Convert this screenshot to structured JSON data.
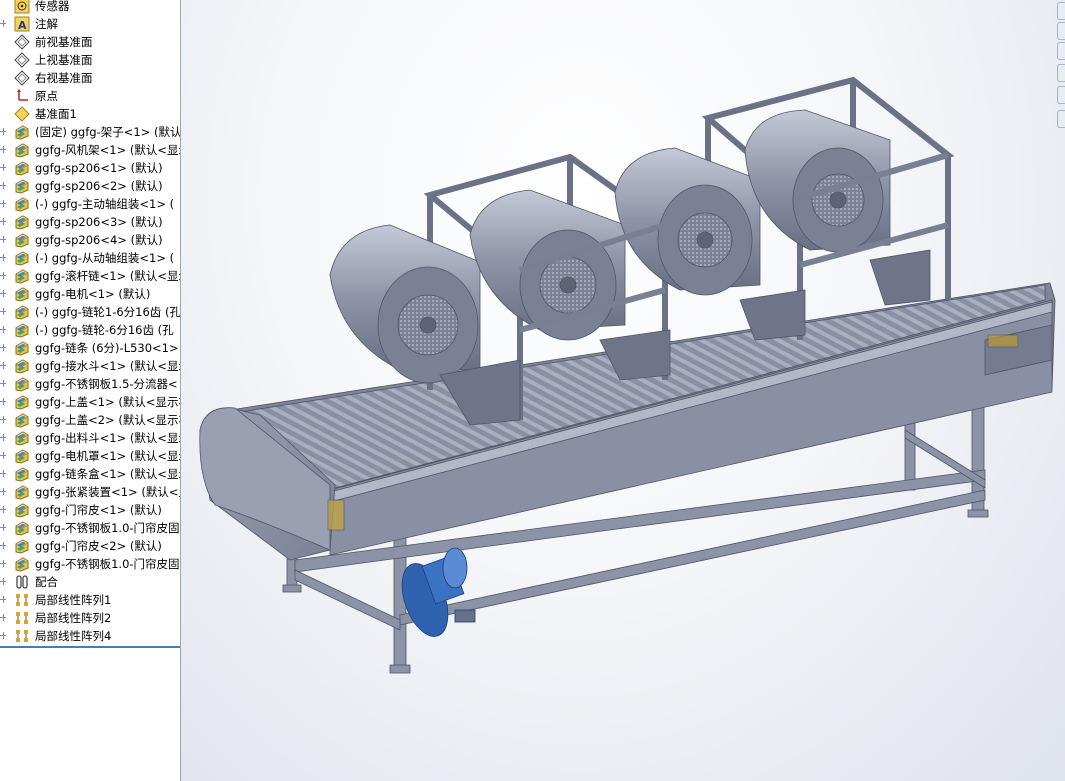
{
  "tree": {
    "items": [
      {
        "label": "传感器",
        "icon": "sensor-icon",
        "expander": false
      },
      {
        "label": "注解",
        "icon": "annotation-icon",
        "expander": true
      },
      {
        "label": "前视基准面",
        "icon": "plane-icon",
        "expander": false
      },
      {
        "label": "上视基准面",
        "icon": "plane-icon",
        "expander": false
      },
      {
        "label": "右视基准面",
        "icon": "plane-icon",
        "expander": false
      },
      {
        "label": "原点",
        "icon": "origin-icon",
        "expander": false
      },
      {
        "label": "基准面1",
        "icon": "reference-plane-icon",
        "expander": false
      },
      {
        "label": "(固定) ggfg-架子<1> (默认",
        "icon": "part-icon",
        "expander": true
      },
      {
        "label": "ggfg-风机架<1> (默认<显示",
        "icon": "part-icon",
        "expander": true
      },
      {
        "label": "ggfg-sp206<1> (默认)",
        "icon": "part-icon",
        "expander": true
      },
      {
        "label": "ggfg-sp206<2> (默认)",
        "icon": "part-icon",
        "expander": true
      },
      {
        "label": "(-) ggfg-主动轴组装<1> (",
        "icon": "part-icon",
        "expander": true
      },
      {
        "label": "ggfg-sp206<3> (默认)",
        "icon": "part-icon",
        "expander": true
      },
      {
        "label": "ggfg-sp206<4> (默认)",
        "icon": "part-icon",
        "expander": true
      },
      {
        "label": "(-) ggfg-从动轴组装<1> (",
        "icon": "part-icon",
        "expander": true
      },
      {
        "label": "ggfg-滚杆链<1> (默认<显示",
        "icon": "part-icon",
        "expander": true
      },
      {
        "label": "ggfg-电机<1> (默认)",
        "icon": "part-icon",
        "expander": true
      },
      {
        "label": "(-) ggfg-链轮1-6分16齿 (孔",
        "icon": "part-icon",
        "expander": true
      },
      {
        "label": "(-) ggfg-链轮-6分16齿 (孔",
        "icon": "part-icon",
        "expander": true
      },
      {
        "label": "ggfg-链条 (6分)-L530<1> (",
        "icon": "part-icon",
        "expander": true
      },
      {
        "label": "ggfg-接水斗<1> (默认<显示",
        "icon": "part-icon",
        "expander": true
      },
      {
        "label": "ggfg-不锈钢板1.5-分流器<",
        "icon": "part-icon",
        "expander": true
      },
      {
        "label": "ggfg-上盖<1> (默认<显示状",
        "icon": "part-icon",
        "expander": true
      },
      {
        "label": "ggfg-上盖<2> (默认<显示状",
        "icon": "part-icon",
        "expander": true
      },
      {
        "label": "ggfg-出料斗<1> (默认<显示",
        "icon": "part-icon",
        "expander": true
      },
      {
        "label": "ggfg-电机罩<1> (默认<显示",
        "icon": "part-icon",
        "expander": true
      },
      {
        "label": "ggfg-链条盒<1> (默认<显示",
        "icon": "part-icon",
        "expander": true
      },
      {
        "label": "ggfg-张紧装置<1> (默认<显",
        "icon": "part-icon",
        "expander": true
      },
      {
        "label": "ggfg-门帘皮<1> (默认)",
        "icon": "part-icon",
        "expander": true
      },
      {
        "label": "ggfg-不锈钢板1.0-门帘皮固",
        "icon": "part-icon",
        "expander": true
      },
      {
        "label": "ggfg-门帘皮<2> (默认)",
        "icon": "part-icon",
        "expander": true
      },
      {
        "label": "ggfg-不锈钢板1.0-门帘皮固",
        "icon": "part-icon",
        "expander": true
      },
      {
        "label": "配合",
        "icon": "mates-icon",
        "expander": true
      },
      {
        "label": "局部线性阵列1",
        "icon": "linear-pattern-icon",
        "expander": true
      },
      {
        "label": "局部线性阵列2",
        "icon": "linear-pattern-icon",
        "expander": true
      },
      {
        "label": "局部线性阵列4",
        "icon": "linear-pattern-icon",
        "expander": true
      }
    ]
  },
  "splitter": {
    "glyph": "‹"
  },
  "colors": {
    "metal": "#8d93a6",
    "metal_dark": "#5e6476",
    "metal_light": "#b9bfce",
    "motor": "#2f63b0",
    "selection_line": "#4a7ab8"
  }
}
